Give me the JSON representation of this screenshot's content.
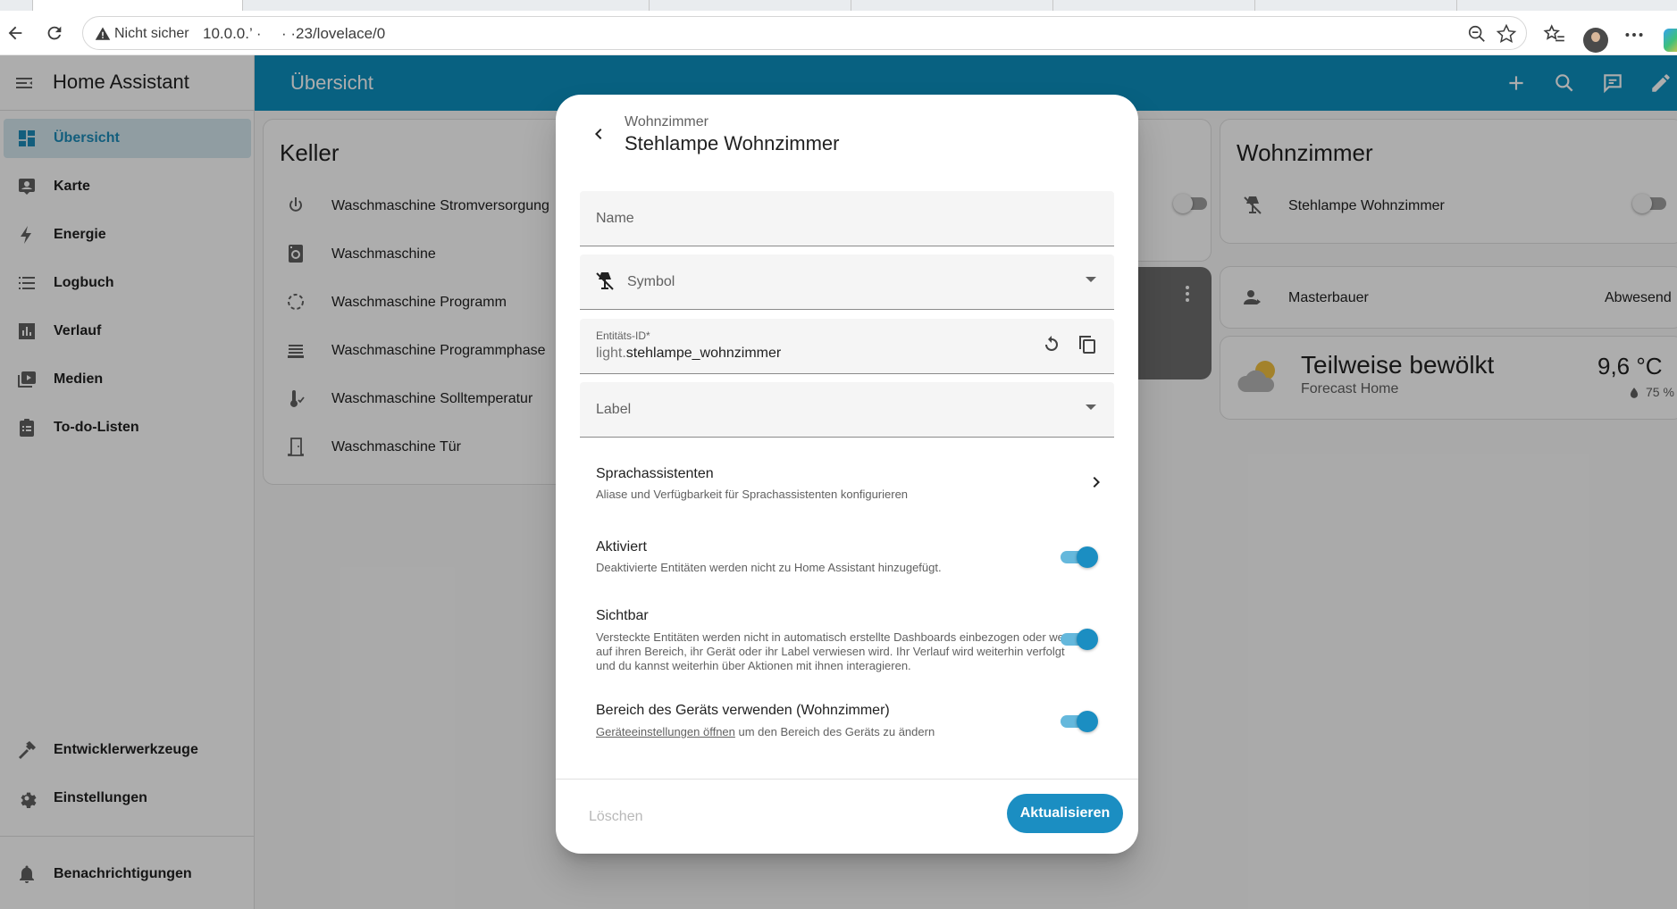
{
  "browser": {
    "not_secure_label": "Nicht sicher",
    "url_host": "10.0.0.’ ·",
    "url_path": "· ·23/lovelace/0"
  },
  "sidebar": {
    "title": "Home Assistant",
    "items": [
      {
        "label": "Übersicht",
        "icon": "dashboard-icon"
      },
      {
        "label": "Karte",
        "icon": "map-icon"
      },
      {
        "label": "Energie",
        "icon": "lightning-icon"
      },
      {
        "label": "Logbuch",
        "icon": "logbook-icon"
      },
      {
        "label": "Verlauf",
        "icon": "chart-icon"
      },
      {
        "label": "Medien",
        "icon": "media-icon"
      },
      {
        "label": "To-do-Listen",
        "icon": "clipboard-icon"
      }
    ],
    "bottom_items": [
      {
        "label": "Entwicklerwerkzeuge",
        "icon": "hammer-icon"
      },
      {
        "label": "Einstellungen",
        "icon": "gear-icon"
      }
    ],
    "notifications_label": "Benachrichtigungen"
  },
  "appbar": {
    "title": "Übersicht"
  },
  "keller": {
    "title": "Keller",
    "items": [
      {
        "label": "Waschmaschine Stromversorgung",
        "icon": "power-icon"
      },
      {
        "label": "Waschmaschine",
        "icon": "washing-machine-icon"
      },
      {
        "label": "Waschmaschine Programm",
        "icon": "dashed-circle-icon"
      },
      {
        "label": "Waschmaschine Programmphase",
        "icon": "tray-icon"
      },
      {
        "label": "Waschmaschine Solltemperatur",
        "icon": "thermometer-icon"
      },
      {
        "label": "Waschmaschine Tür",
        "icon": "door-icon"
      }
    ]
  },
  "wohnzimmer": {
    "title": "Wohnzimmer",
    "lamp_label": "Stehlampe Wohnzimmer",
    "person_label": "Masterbauer",
    "person_state": "Abwesend"
  },
  "weather": {
    "condition": "Teilweise bewölkt",
    "location": "Forecast Home",
    "temperature": "9,6 °C",
    "humidity": "75 %"
  },
  "dialog": {
    "subtitle": "Wohnzimmer",
    "title": "Stehlampe Wohnzimmer",
    "name_placeholder": "Name",
    "symbol_placeholder": "Symbol",
    "entity_id_label": "Entitäts-ID*",
    "entity_id_prefix": "light.",
    "entity_id_value": "stehlampe_wohnzimmer",
    "label_placeholder": "Label",
    "voice": {
      "title": "Sprachassistenten",
      "desc": "Aliase und Verfügbarkeit für Sprachassistenten konfigurieren"
    },
    "enabled": {
      "title": "Aktiviert",
      "desc": "Deaktivierte Entitäten werden nicht zu Home Assistant hinzugefügt.",
      "on": true
    },
    "visible": {
      "title": "Sichtbar",
      "desc": "Versteckte Entitäten werden nicht in automatisch erstellte Dashboards einbezogen oder wenn auf ihren Bereich, ihr Gerät oder ihr Label verwiesen wird. Ihr Verlauf wird weiterhin verfolgt und du kannst weiterhin über Aktionen mit ihnen interagieren.",
      "on": true
    },
    "area": {
      "title": "Bereich des Geräts verwenden (Wohnzimmer)",
      "desc_link": "Geräteeinstellungen öffnen",
      "desc_rest": " um den Bereich des Geräts zu ändern",
      "on": true
    },
    "delete_label": "Löschen",
    "update_label": "Aktualisieren"
  },
  "colors": {
    "accent": "#1b8ec2",
    "appbar": "#0d8fbf"
  }
}
